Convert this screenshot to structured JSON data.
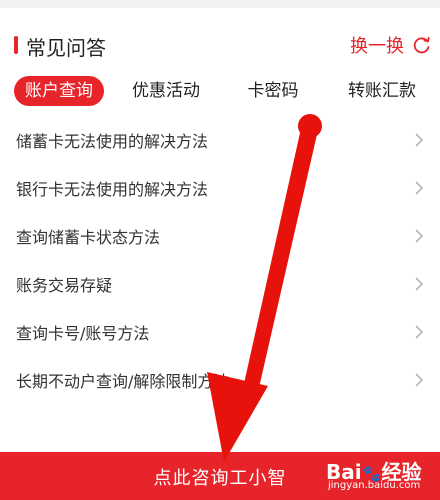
{
  "header": {
    "title": "常见问答",
    "refresh_label": "换一换"
  },
  "tabs": [
    {
      "label": "账户查询",
      "active": true
    },
    {
      "label": "优惠活动",
      "active": false
    },
    {
      "label": "卡密码",
      "active": false
    },
    {
      "label": "转账汇款",
      "active": false
    }
  ],
  "faq": [
    {
      "label": "储蓄卡无法使用的解决方法"
    },
    {
      "label": "银行卡无法使用的解决方法"
    },
    {
      "label": "查询储蓄卡状态方法"
    },
    {
      "label": "账务交易存疑"
    },
    {
      "label": "查询卡号/账号方法"
    },
    {
      "label": "长期不动户查询/解除限制方法"
    }
  ],
  "footer": {
    "button_label": "点此咨询工小智"
  },
  "watermark": {
    "logo": "Bai du 经验",
    "url": "jingyan.baidu.com"
  },
  "colors": {
    "accent": "#e8242b",
    "annotation_arrow": "#e8120c"
  },
  "icons": {
    "refresh": "refresh-icon",
    "chevron": "chevron-right-icon"
  }
}
